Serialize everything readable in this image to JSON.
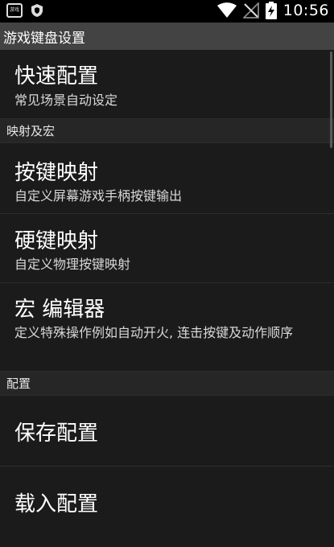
{
  "status_bar": {
    "app_icon_text": "游戏键",
    "time": "10:56"
  },
  "title_bar": {
    "title": "游戏键盘设置"
  },
  "quick": {
    "title": "快速配置",
    "subtitle": "常见场景自动设定"
  },
  "sections": {
    "mapping": "映射及宏",
    "config": "配置"
  },
  "items": {
    "key_mapping": {
      "title": "按键映射",
      "subtitle": "自定义屏幕游戏手柄按键输出"
    },
    "hard_key_mapping": {
      "title": "硬键映射",
      "subtitle": "自定义物理按键映射"
    },
    "macro_editor": {
      "title": "宏 编辑器",
      "subtitle": "定义特殊操作例如自动开火, 连击按键及动作顺序"
    },
    "save_config": {
      "title": "保存配置"
    },
    "load_config": {
      "title": "载入配置"
    }
  },
  "icons": [
    "app-icon",
    "shield-icon",
    "wifi-icon",
    "no-signal-icon",
    "battery-charging-icon"
  ]
}
